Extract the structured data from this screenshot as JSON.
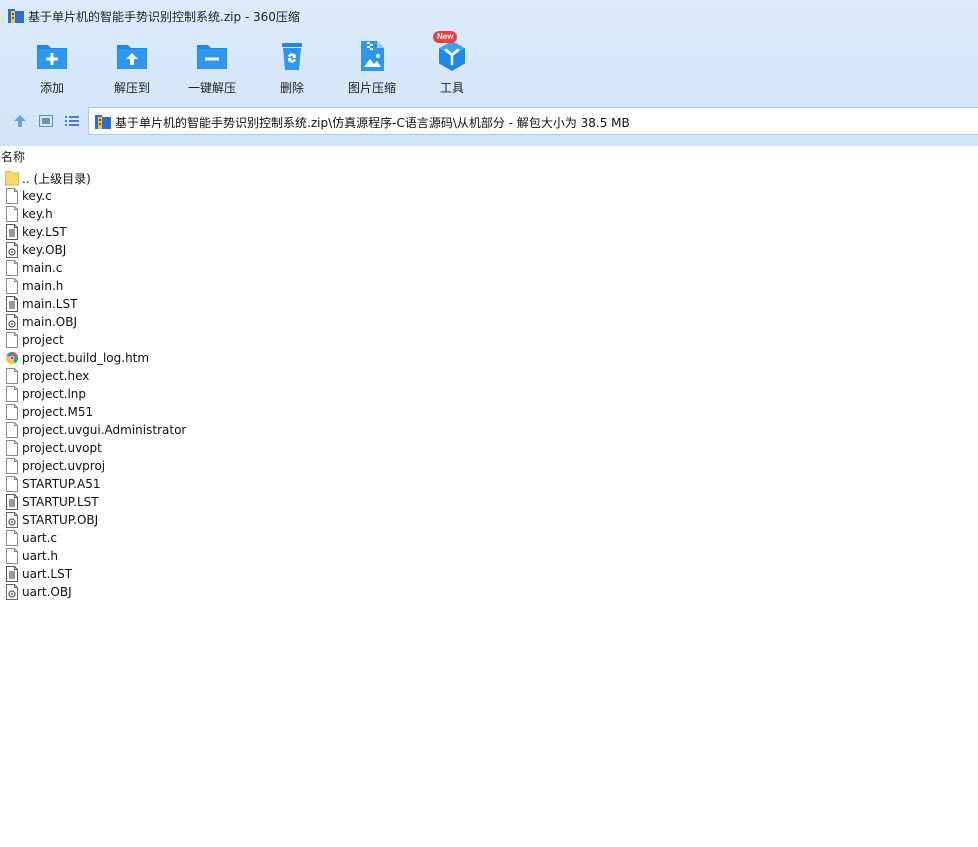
{
  "window": {
    "title": "基于单片机的智能手势识别控制系统.zip - 360压缩"
  },
  "toolbar": {
    "items": [
      {
        "label": "添加",
        "icon": "add-folder-icon"
      },
      {
        "label": "解压到",
        "icon": "extract-to-icon"
      },
      {
        "label": "一键解压",
        "icon": "one-click-extract-icon"
      },
      {
        "label": "删除",
        "icon": "delete-bin-icon"
      },
      {
        "label": "图片压缩",
        "icon": "image-compress-icon"
      },
      {
        "label": "工具",
        "icon": "tools-icon",
        "badge": "New"
      }
    ]
  },
  "address": {
    "path": "基于单片机的智能手势识别控制系统.zip\\仿真源程序-C语言源码\\从机部分 - 解包大小为 38.5 MB"
  },
  "list": {
    "column_name": "名称",
    "items": [
      {
        "name": ".. (上级目录)",
        "type": "folder-up"
      },
      {
        "name": "key.c",
        "type": "blank"
      },
      {
        "name": "key.h",
        "type": "blank"
      },
      {
        "name": "key.LST",
        "type": "text"
      },
      {
        "name": "key.OBJ",
        "type": "obj"
      },
      {
        "name": "main.c",
        "type": "blank"
      },
      {
        "name": "main.h",
        "type": "blank"
      },
      {
        "name": "main.LST",
        "type": "text"
      },
      {
        "name": "main.OBJ",
        "type": "obj"
      },
      {
        "name": "project",
        "type": "blank"
      },
      {
        "name": "project.build_log.htm",
        "type": "htm"
      },
      {
        "name": "project.hex",
        "type": "blank"
      },
      {
        "name": "project.lnp",
        "type": "blank"
      },
      {
        "name": "project.M51",
        "type": "blank"
      },
      {
        "name": "project.uvgui.Administrator",
        "type": "blank"
      },
      {
        "name": "project.uvopt",
        "type": "blank"
      },
      {
        "name": "project.uvproj",
        "type": "blank"
      },
      {
        "name": "STARTUP.A51",
        "type": "blank"
      },
      {
        "name": "STARTUP.LST",
        "type": "text"
      },
      {
        "name": "STARTUP.OBJ",
        "type": "obj"
      },
      {
        "name": "uart.c",
        "type": "blank"
      },
      {
        "name": "uart.h",
        "type": "blank"
      },
      {
        "name": "uart.LST",
        "type": "text"
      },
      {
        "name": "uart.OBJ",
        "type": "obj"
      }
    ]
  },
  "colors": {
    "accent": "#1e88e5",
    "toolbar_bg": "#d5e7fa",
    "folder": "#f8d76b"
  }
}
